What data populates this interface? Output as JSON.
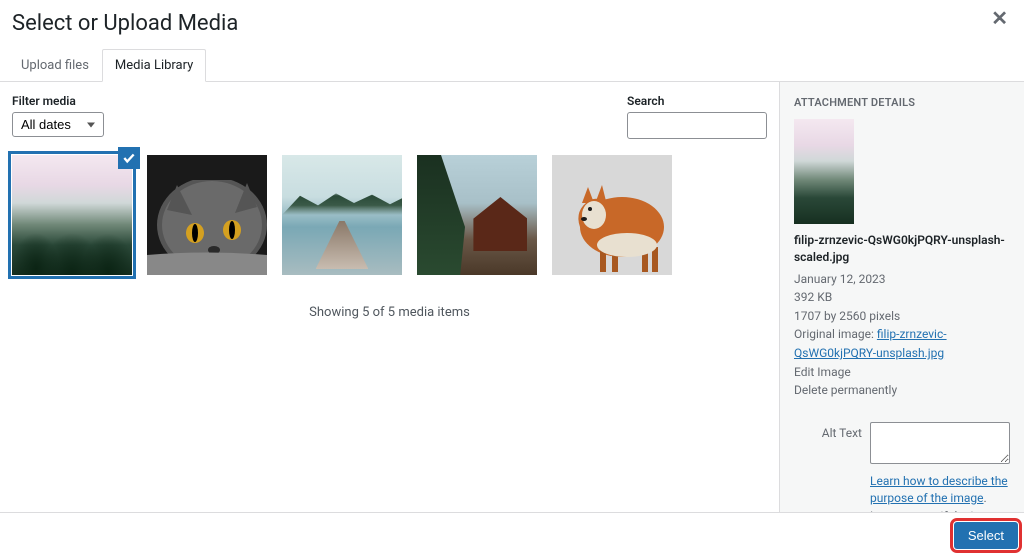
{
  "modal": {
    "title": "Select or Upload Media",
    "close_glyph": "✕"
  },
  "tabs": {
    "upload": "Upload files",
    "library": "Media Library"
  },
  "toolbar": {
    "filter_label": "Filter media",
    "filter_value": "All dates",
    "search_label": "Search"
  },
  "media_count": "Showing 5 of 5 media items",
  "media_items": [
    {
      "id": "forest",
      "selected": true
    },
    {
      "id": "cat",
      "selected": false
    },
    {
      "id": "lake",
      "selected": false
    },
    {
      "id": "cabin",
      "selected": false
    },
    {
      "id": "fox",
      "selected": false
    }
  ],
  "details": {
    "heading": "ATTACHMENT DETAILS",
    "filename": "filip-zrnzevic-QsWG0kjPQRY-unsplash-scaled.jpg",
    "date": "January 12, 2023",
    "size": "392 KB",
    "dimensions": "1707 by 2560 pixels",
    "original_label": "Original image: ",
    "original_link": "filip-zrnzevic-QsWG0kjPQRY-unsplash.jpg",
    "edit_link": "Edit Image",
    "delete_link": "Delete permanently",
    "alt_label": "Alt Text",
    "alt_value": "",
    "help_link": "Learn how to describe the purpose of the image",
    "help_suffix": ". Leave empty if the image is purely decorative."
  },
  "footer": {
    "select_label": "Select"
  }
}
